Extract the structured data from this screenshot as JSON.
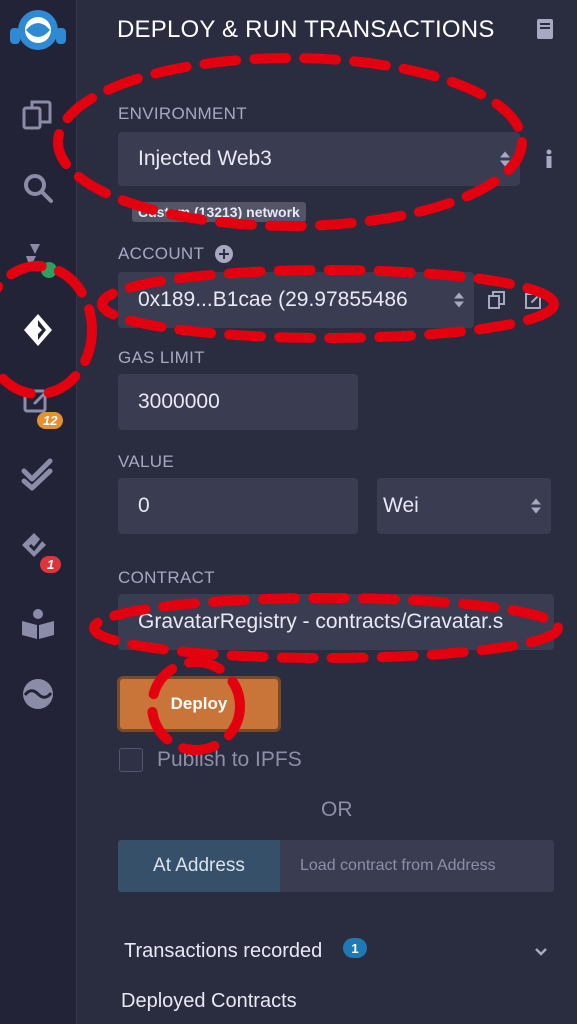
{
  "sidebar": {
    "badge_edit": "12",
    "badge_verify": "1"
  },
  "header": {
    "title": "DEPLOY & RUN TRANSACTIONS"
  },
  "environment": {
    "label": "ENVIRONMENT",
    "value": "Injected Web3",
    "network_tag": "Custom (13213) network"
  },
  "account": {
    "label": "ACCOUNT",
    "value": "0x189...B1cae (29.97855486"
  },
  "gas_limit": {
    "label": "GAS LIMIT",
    "value": "3000000"
  },
  "value_field": {
    "label": "VALUE",
    "amount": "0",
    "unit": "Wei"
  },
  "contract": {
    "label": "CONTRACT",
    "value": "GravatarRegistry - contracts/Gravatar.s"
  },
  "deploy_label": "Deploy",
  "publish_label": "Publish to IPFS",
  "or_label": "OR",
  "at_address": {
    "button": "At Address",
    "placeholder": "Load contract from Address"
  },
  "transactions": {
    "label": "Transactions recorded",
    "count": "1"
  },
  "deployed_label": "Deployed Contracts",
  "annotation_color": "#e3000f"
}
